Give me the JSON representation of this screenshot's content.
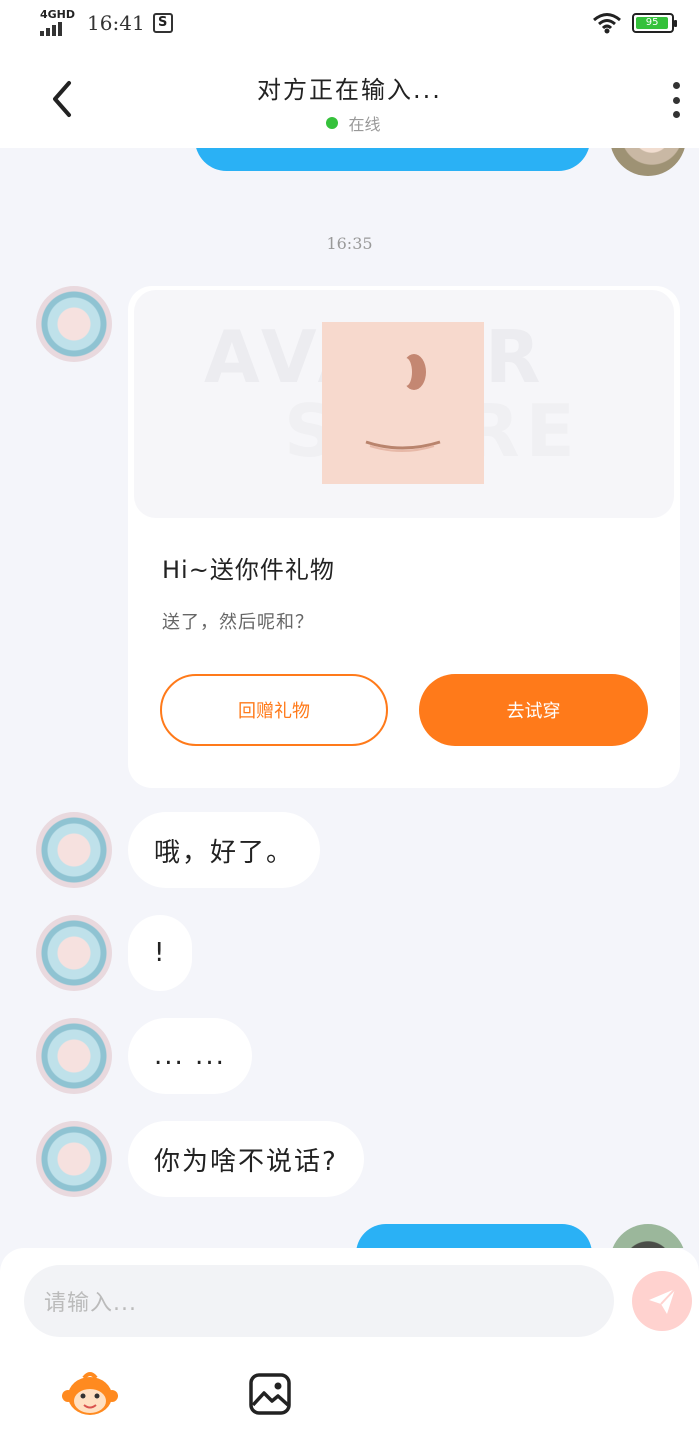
{
  "status_bar": {
    "network": "4GHD",
    "time": "16:41",
    "s_icon": "S",
    "battery_level": "95",
    "battery_fraction": 0.95
  },
  "header": {
    "title": "对方正在输入...",
    "presence": "在线",
    "presence_color": "#35c13b",
    "back_icon": "chevron-left-icon",
    "more_icon": "more-vertical-icon"
  },
  "chat": {
    "timestamp": "16:35",
    "gift_card": {
      "watermark_line1": "AVATAR",
      "watermark_line2": "STORE",
      "title": "Hi~送你件礼物",
      "subtitle": "送了，然后呢和？",
      "return_gift_label": "回赠礼物",
      "try_on_label": "去试穿",
      "accent_color": "#ff7a1a"
    },
    "incoming_messages": [
      {
        "text": "哦，好了。"
      },
      {
        "text": "!"
      },
      {
        "text": "... ..."
      },
      {
        "text": "你为啥不说话?"
      }
    ],
    "outgoing_bubble_color": "#2ab1f5"
  },
  "composer": {
    "placeholder": "请输入...",
    "send_icon": "paper-plane-icon",
    "emoji_icon": "monkey-emoji-icon",
    "image_icon": "image-icon"
  }
}
